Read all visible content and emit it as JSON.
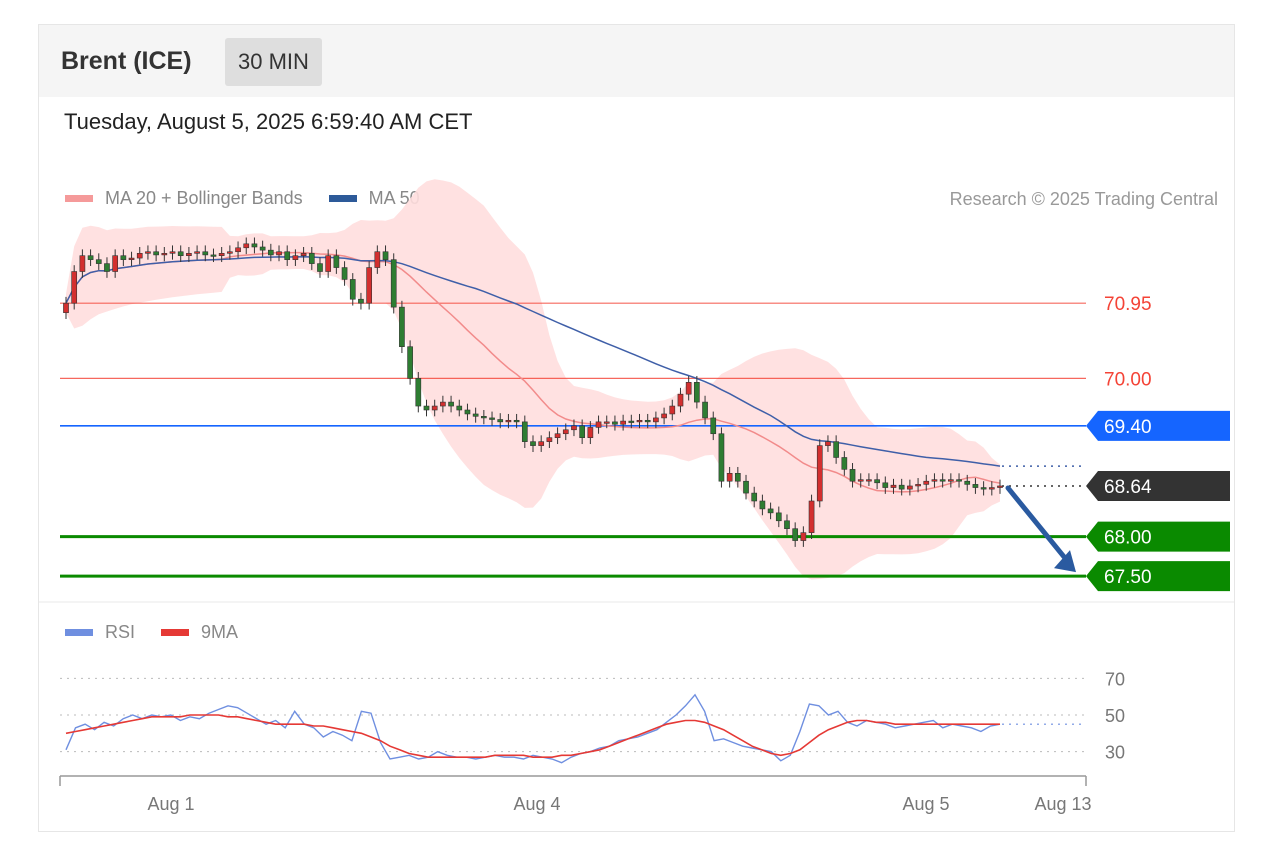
{
  "header": {
    "title": "Brent (ICE)",
    "timeframe": "30 MIN",
    "datetime": "Tuesday, August 5, 2025 6:59:40 AM CET"
  },
  "legend": {
    "ma20_label": "MA 20 + Bollinger Bands",
    "ma50_label": "MA 50",
    "credit": "Research © 2025 Trading Central"
  },
  "rsi_legend": {
    "rsi_label": "RSI",
    "ma9_label": "9MA"
  },
  "colors": {
    "ma20": "#f28b8b",
    "ma50": "#3f5fa8",
    "band": "#ffdede",
    "bull": "#d32f2f",
    "bear": "#2e7d32",
    "resistance": "#f44336",
    "pivot": "#1565ff",
    "support": "#0a8a00",
    "last": "#333333",
    "rsi": "#6f8fe0",
    "rsi_ma": "#e53935",
    "arrow": "#2a5aa0"
  },
  "chart_data": [
    {
      "type": "candlestick",
      "interval": "30 MIN",
      "ylim": [
        67.3,
        71.9
      ],
      "x_ticks": [
        "Aug 1",
        "Aug 4",
        "Aug 5",
        "Aug 13"
      ],
      "close": [
        70.95,
        71.35,
        71.55,
        71.5,
        71.45,
        71.35,
        71.55,
        71.5,
        71.52,
        71.58,
        71.6,
        71.56,
        71.58,
        71.6,
        71.55,
        71.58,
        71.6,
        71.56,
        71.55,
        71.58,
        71.6,
        71.65,
        71.7,
        71.66,
        71.62,
        71.56,
        71.6,
        71.5,
        71.55,
        71.58,
        71.45,
        71.35,
        71.55,
        71.4,
        71.25,
        71.0,
        70.95,
        71.4,
        71.6,
        71.5,
        70.9,
        70.4,
        70.0,
        69.65,
        69.6,
        69.65,
        69.7,
        69.65,
        69.6,
        69.55,
        69.52,
        69.5,
        69.48,
        69.45,
        69.47,
        69.45,
        69.2,
        69.15,
        69.2,
        69.25,
        69.3,
        69.35,
        69.4,
        69.25,
        69.38,
        69.45,
        69.45,
        69.42,
        69.46,
        69.45,
        69.47,
        69.45,
        69.5,
        69.55,
        69.65,
        69.8,
        69.95,
        69.7,
        69.5,
        69.3,
        68.7,
        68.8,
        68.7,
        68.55,
        68.45,
        68.35,
        68.3,
        68.2,
        68.1,
        67.95,
        68.05,
        68.45,
        69.15,
        69.2,
        69.0,
        68.85,
        68.7,
        68.72,
        68.72,
        68.68,
        68.62,
        68.65,
        68.6,
        68.64,
        68.66,
        68.7,
        68.72,
        68.7,
        68.72,
        68.7,
        68.66,
        68.62,
        68.6,
        68.62,
        68.64
      ],
      "levels": [
        {
          "price": "70.95",
          "type": "resistance"
        },
        {
          "price": "70.00",
          "type": "resistance"
        },
        {
          "price": "69.40",
          "type": "pivot"
        },
        {
          "price": "68.64",
          "type": "last"
        },
        {
          "price": "68.00",
          "type": "support"
        },
        {
          "price": "67.50",
          "type": "support"
        }
      ],
      "forecast_arrow": {
        "from": 68.64,
        "to": 67.5
      }
    },
    {
      "type": "line",
      "ylim": [
        20,
        80
      ],
      "y_ticks": [
        "70",
        "50",
        "30"
      ],
      "series": [
        {
          "name": "RSI",
          "values": [
            31,
            43,
            45,
            42,
            46,
            44,
            48,
            50,
            48,
            50,
            49,
            50,
            47,
            49,
            48,
            51,
            53,
            55,
            54,
            51,
            48,
            45,
            47,
            43,
            52,
            45,
            43,
            38,
            41,
            39,
            36,
            52,
            51,
            35,
            26,
            27,
            28,
            26,
            27,
            30,
            28,
            27,
            27,
            26,
            27,
            28,
            27,
            27,
            26,
            28,
            27,
            26,
            24,
            27,
            29,
            30,
            32,
            33,
            36,
            37,
            38,
            40,
            42,
            46,
            50,
            55,
            61,
            52,
            36,
            37,
            35,
            33,
            32,
            31,
            30,
            25,
            28,
            41,
            56,
            55,
            50,
            52,
            46,
            44,
            47,
            46,
            45,
            43,
            44,
            45,
            46,
            47,
            43,
            45,
            44,
            43,
            41,
            44,
            45
          ]
        },
        {
          "name": "9MA",
          "values": [
            40,
            41,
            42,
            43,
            44,
            45,
            46,
            47,
            48,
            49,
            49,
            49,
            49,
            50,
            50,
            50,
            50,
            49,
            49,
            48,
            47,
            46,
            45,
            45,
            45,
            45,
            44,
            44,
            43,
            42,
            41,
            40,
            38,
            36,
            33,
            31,
            29,
            28,
            27,
            27,
            27,
            27,
            27,
            27,
            27,
            28,
            28,
            28,
            28,
            27,
            27,
            27,
            28,
            28,
            29,
            30,
            31,
            33,
            35,
            37,
            39,
            41,
            43,
            45,
            46,
            47,
            47,
            46,
            44,
            42,
            39,
            36,
            33,
            31,
            29,
            28,
            29,
            31,
            35,
            39,
            42,
            44,
            46,
            47,
            47,
            46,
            46,
            45,
            45,
            45,
            45,
            45,
            45,
            45,
            45,
            45,
            45,
            45,
            45
          ]
        }
      ]
    }
  ]
}
